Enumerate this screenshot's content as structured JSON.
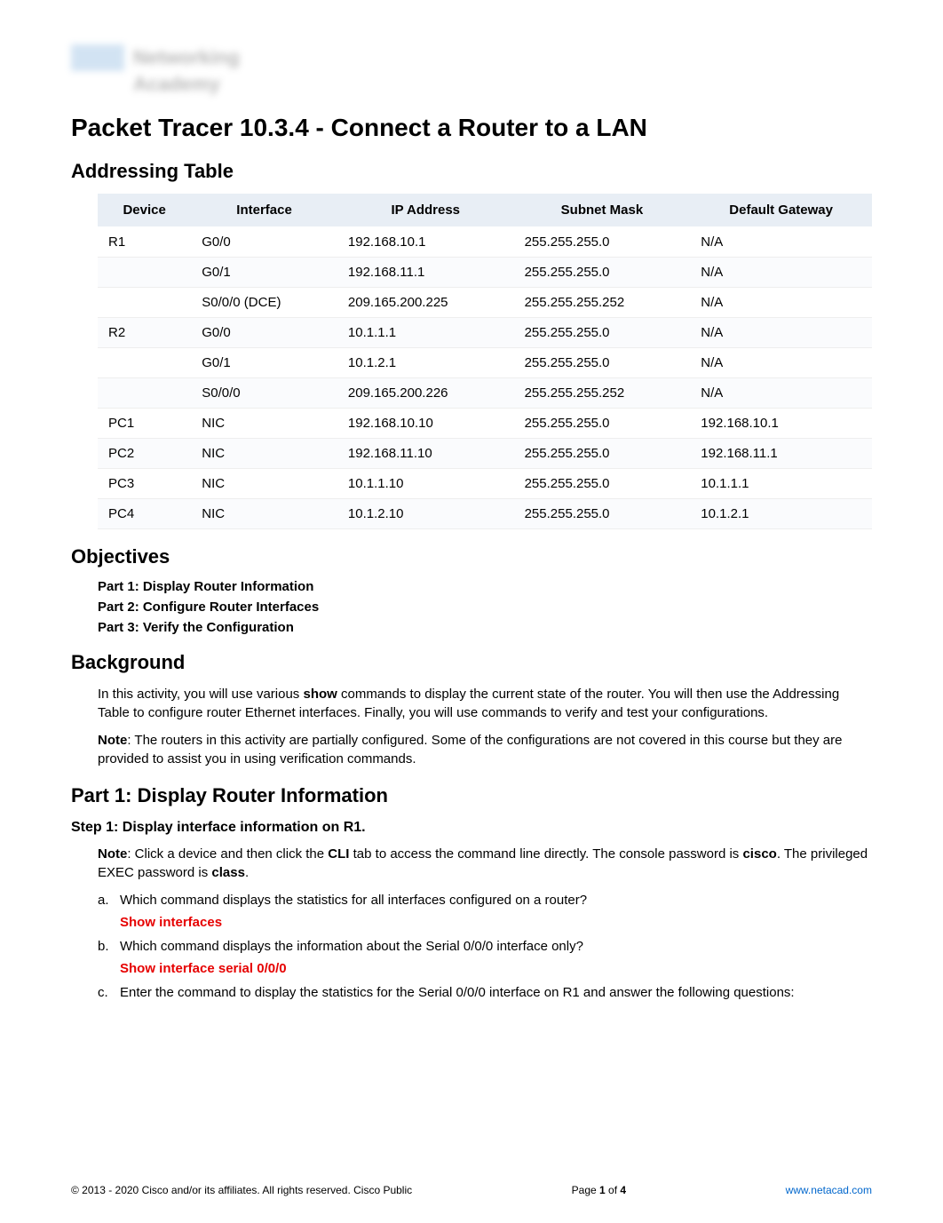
{
  "logo": {
    "text1": "Networking",
    "text2": "Academy"
  },
  "title": "Packet Tracer 10.3.4 - Connect a Router to a LAN",
  "addressing_heading": "Addressing Table",
  "table": {
    "headers": [
      "Device",
      "Interface",
      "IP Address",
      "Subnet Mask",
      "Default Gateway"
    ],
    "rows": [
      [
        "R1",
        "G0/0",
        "192.168.10.1",
        "255.255.255.0",
        "N/A"
      ],
      [
        "",
        "G0/1",
        "192.168.11.1",
        "255.255.255.0",
        "N/A"
      ],
      [
        "",
        "S0/0/0 (DCE)",
        "209.165.200.225",
        "255.255.255.252",
        "N/A"
      ],
      [
        "R2",
        "G0/0",
        "10.1.1.1",
        "255.255.255.0",
        "N/A"
      ],
      [
        "",
        "G0/1",
        "10.1.2.1",
        "255.255.255.0",
        "N/A"
      ],
      [
        "",
        "S0/0/0",
        "209.165.200.226",
        "255.255.255.252",
        "N/A"
      ],
      [
        "PC1",
        "NIC",
        "192.168.10.10",
        "255.255.255.0",
        "192.168.10.1"
      ],
      [
        "PC2",
        "NIC",
        "192.168.11.10",
        "255.255.255.0",
        "192.168.11.1"
      ],
      [
        "PC3",
        "NIC",
        "10.1.1.10",
        "255.255.255.0",
        "10.1.1.1"
      ],
      [
        "PC4",
        "NIC",
        "10.1.2.10",
        "255.255.255.0",
        "10.1.2.1"
      ]
    ]
  },
  "objectives": {
    "heading": "Objectives",
    "items": [
      "Part 1: Display Router Information",
      "Part 2: Configure Router Interfaces",
      "Part 3: Verify the Configuration"
    ]
  },
  "background": {
    "heading": "Background",
    "para1_pre": "In this activity, you will use various ",
    "para1_bold": "show",
    "para1_post": " commands to display the current state of the router. You will then use the Addressing Table to configure router Ethernet interfaces. Finally, you will use commands to verify and test your configurations.",
    "para2_bold": "Note",
    "para2_post": ": The routers in this activity are partially configured. Some of the configurations are not covered in this course but they are provided to assist you in using verification commands."
  },
  "part1": {
    "heading": "Part 1: Display Router Information",
    "step1_heading": "Step 1: Display interface information on R1.",
    "note_bold": "Note",
    "note_mid1": ": Click a device and then click the ",
    "note_bold2": "CLI",
    "note_mid2": " tab to access the command line directly. The console password is ",
    "note_bold3": "cisco",
    "note_mid3": ". The privileged EXEC password is ",
    "note_bold4": "class",
    "note_end": ".",
    "item_a_letter": "a.",
    "item_a_text": "Which command displays the statistics for all interfaces configured on a router?",
    "answer_a": "Show interfaces",
    "item_b_letter": "b.",
    "item_b_text": "Which command displays the information about the Serial 0/0/0 interface only?",
    "answer_b": "Show interface serial 0/0/0",
    "item_c_letter": "c.",
    "item_c_text": "Enter the command to display the statistics for the Serial 0/0/0 interface on R1 and answer the following questions:"
  },
  "footer": {
    "copyright_symbol": "©",
    "copyright_text": " 2013 - 2020 Cisco and/or its affiliates. All rights reserved. Cisco Public",
    "page_pre": "Page ",
    "page_num": "1",
    "page_mid": " of ",
    "page_total": "4",
    "link": "www.netacad.com"
  }
}
